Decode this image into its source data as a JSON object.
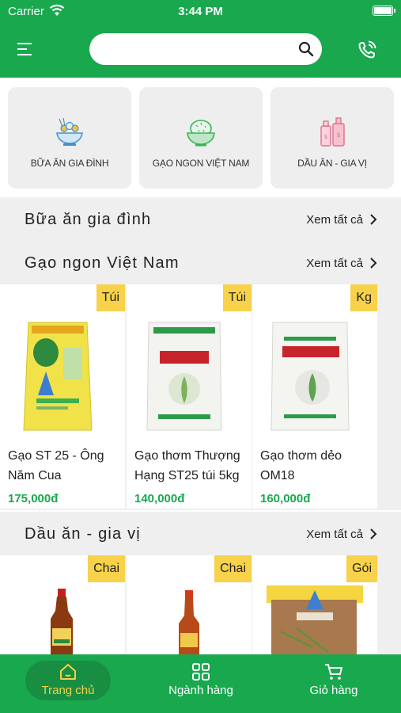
{
  "status_bar": {
    "carrier": "Carrier",
    "time": "3:44 PM"
  },
  "header": {
    "search": {
      "value": "",
      "placeholder": ""
    }
  },
  "categories": [
    {
      "label": "BỮA ĂN GIA ĐÌNH",
      "icon": "family-meal-icon"
    },
    {
      "label": "GẠO NGON VIỆT NAM",
      "icon": "rice-bowl-icon"
    },
    {
      "label": "DẦU ĂN - GIA VỊ",
      "icon": "oil-bottles-icon"
    }
  ],
  "sections": [
    {
      "title": "Bữa ăn gia đình",
      "more": "Xem tất cả"
    },
    {
      "title": "Gạo ngon Việt Nam",
      "more": "Xem tất cả"
    },
    {
      "title": "Dầu ăn - gia vị",
      "more": "Xem tất cả"
    }
  ],
  "rice_products": [
    {
      "badge": "Túi",
      "name": "Gạo ST 25 - Ông Năm Cua",
      "price": "175,000đ"
    },
    {
      "badge": "Túi",
      "name": "Gạo thơm Thượng Hạng ST25 túi 5kg",
      "price": "140,000đ"
    },
    {
      "badge": "Kg",
      "name": "Gạo thơm dẻo OM18",
      "price": "160,000đ"
    }
  ],
  "oil_products": [
    {
      "badge": "Chai"
    },
    {
      "badge": "Chai"
    },
    {
      "badge": "Gói"
    }
  ],
  "tabbar": [
    {
      "label": "Trang chủ",
      "icon": "home-icon",
      "active": true
    },
    {
      "label": "Ngành hàng",
      "icon": "grid-icon"
    },
    {
      "label": "Giỏ hàng",
      "icon": "cart-icon"
    }
  ],
  "colors": {
    "brand": "#19a84e",
    "badge": "#f7d24a",
    "active_tab_text": "#f2d24a"
  }
}
